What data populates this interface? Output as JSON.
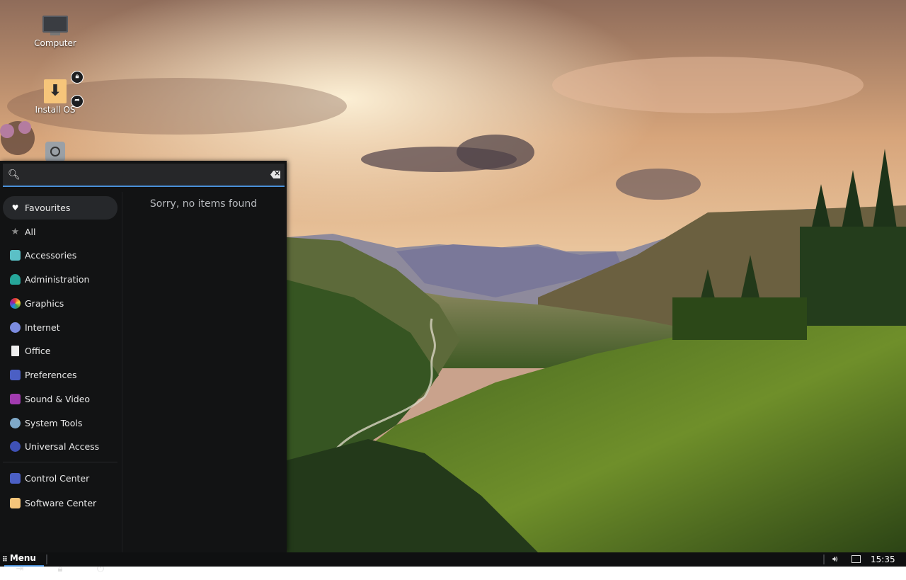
{
  "desktop": {
    "icons": [
      {
        "label": "Computer",
        "icon": "computer-icon"
      },
      {
        "label": "Install OS",
        "icon": "installer-icon"
      },
      {
        "label": "",
        "icon": "disk-icon"
      }
    ]
  },
  "menu": {
    "search": {
      "value": "",
      "placeholder": ""
    },
    "categories": [
      {
        "label": "Favourites",
        "icon": "heart-icon",
        "color": "#ffffff",
        "active": true
      },
      {
        "label": "All",
        "icon": "star-icon",
        "color": "#8a8a8a"
      },
      {
        "label": "Accessories",
        "icon": "accessories-icon",
        "color": "#5bc0c6"
      },
      {
        "label": "Administration",
        "icon": "administration-icon",
        "color": "#26a69a"
      },
      {
        "label": "Graphics",
        "icon": "graphics-icon",
        "color": "#e06b3a"
      },
      {
        "label": "Internet",
        "icon": "internet-icon",
        "color": "#7c8ce0"
      },
      {
        "label": "Office",
        "icon": "office-icon",
        "color": "#eeeeee"
      },
      {
        "label": "Preferences",
        "icon": "preferences-icon",
        "color": "#4b5fc4"
      },
      {
        "label": "Sound & Video",
        "icon": "sound-video-icon",
        "color": "#a23bb0"
      },
      {
        "label": "System Tools",
        "icon": "system-tools-icon",
        "color": "#7fa9c9"
      },
      {
        "label": "Universal Access",
        "icon": "universal-access-icon",
        "color": "#3f51b5"
      }
    ],
    "pinned": [
      {
        "label": "Control Center",
        "icon": "control-center-icon",
        "color": "#4b5fc4"
      },
      {
        "label": "Software Center",
        "icon": "software-center-icon",
        "color": "#f6c57a"
      }
    ],
    "actions": [
      {
        "name": "logout",
        "icon": "logout-icon"
      },
      {
        "name": "lock",
        "icon": "lock-icon"
      },
      {
        "name": "power",
        "icon": "power-icon"
      }
    ],
    "empty_message": "Sorry, no items found"
  },
  "taskbar": {
    "menu_label": "Menu",
    "clock": "15:35"
  },
  "colors": {
    "accent": "#4a90d9",
    "menu_bg": "#121314",
    "taskbar_bg": "#0f1011"
  }
}
